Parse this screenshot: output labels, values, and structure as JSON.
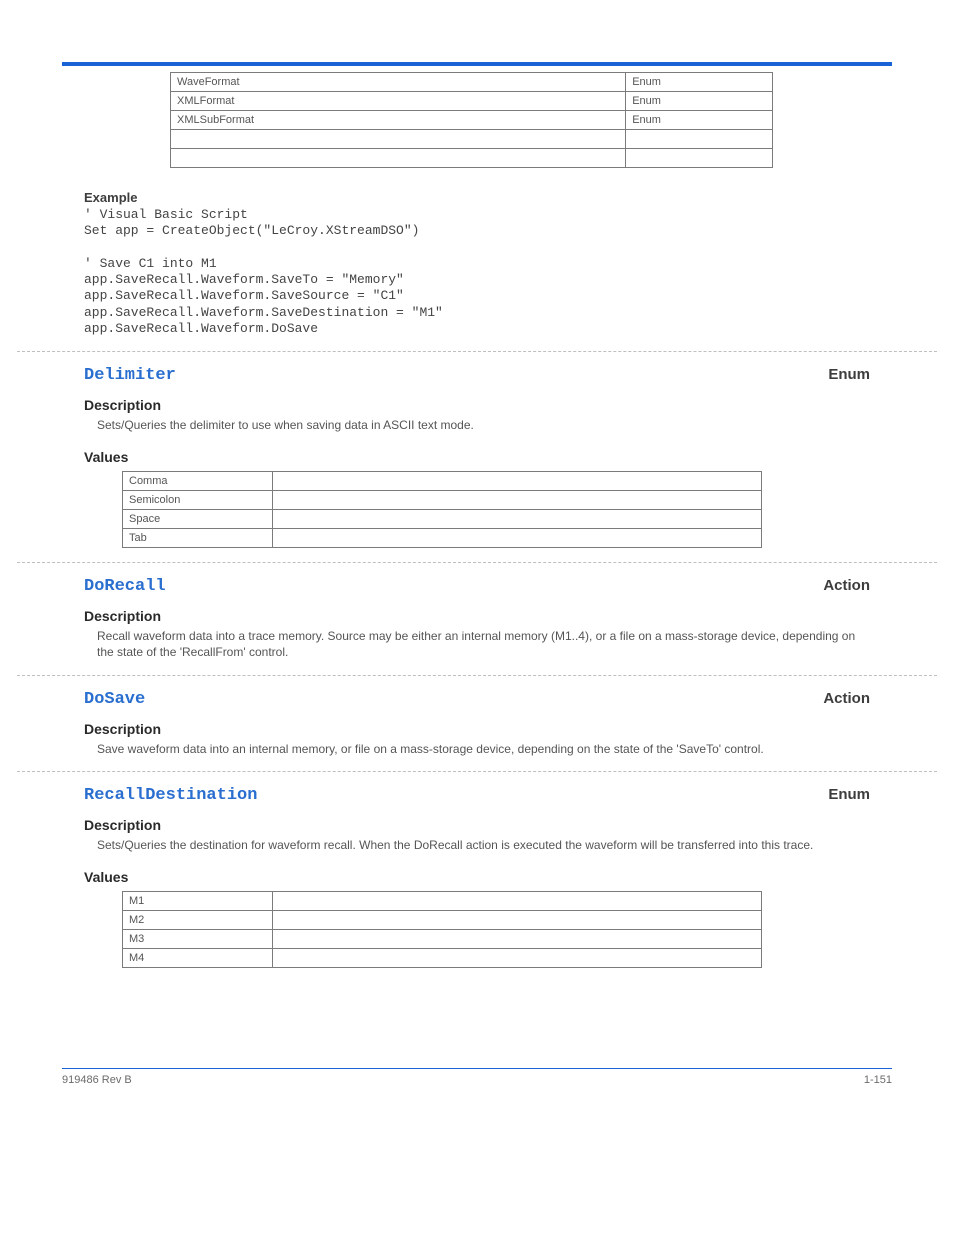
{
  "top_table": [
    {
      "left": "WaveFormat",
      "right": "Enum"
    },
    {
      "left": "XMLFormat",
      "right": "Enum"
    },
    {
      "left": "XMLSubFormat",
      "right": "Enum"
    },
    {
      "left": "",
      "right": ""
    },
    {
      "left": "",
      "right": ""
    }
  ],
  "example": {
    "label": "Example",
    "code": "' Visual Basic Script\nSet app = CreateObject(\"LeCroy.XStreamDSO\")\n\n' Save C1 into M1\napp.SaveRecall.Waveform.SaveTo = \"Memory\"\napp.SaveRecall.Waveform.SaveSource = \"C1\"\napp.SaveRecall.Waveform.SaveDestination = \"M1\"\napp.SaveRecall.Waveform.DoSave"
  },
  "sections": [
    {
      "title": "Delimiter",
      "type": "Enum",
      "desc_heading": "Description",
      "desc": "Sets/Queries the delimiter to use when saving data in ASCII text mode.",
      "values_heading": "Values",
      "values": [
        {
          "k": "Comma",
          "v": ""
        },
        {
          "k": "Semicolon",
          "v": ""
        },
        {
          "k": "Space",
          "v": ""
        },
        {
          "k": "Tab",
          "v": ""
        }
      ]
    },
    {
      "title": "DoRecall",
      "type": "Action",
      "desc_heading": "Description",
      "desc": "Recall waveform data into a trace memory. Source may be either an internal memory (M1..4), or a file on a mass-storage device, depending on the state of the 'RecallFrom' control."
    },
    {
      "title": "DoSave",
      "type": "Action",
      "desc_heading": "Description",
      "desc": "Save waveform data into an internal memory, or file on a mass-storage device, depending on the state of the 'SaveTo' control."
    },
    {
      "title": "RecallDestination",
      "type": "Enum",
      "desc_heading": "Description",
      "desc": "Sets/Queries the destination for waveform recall. When the DoRecall action is executed the waveform will be transferred into this trace.",
      "values_heading": "Values",
      "values": [
        {
          "k": "M1",
          "v": ""
        },
        {
          "k": "M2",
          "v": ""
        },
        {
          "k": "M3",
          "v": ""
        },
        {
          "k": "M4",
          "v": ""
        }
      ]
    }
  ],
  "footer": {
    "left": "919486 Rev B",
    "right": "1-151"
  }
}
